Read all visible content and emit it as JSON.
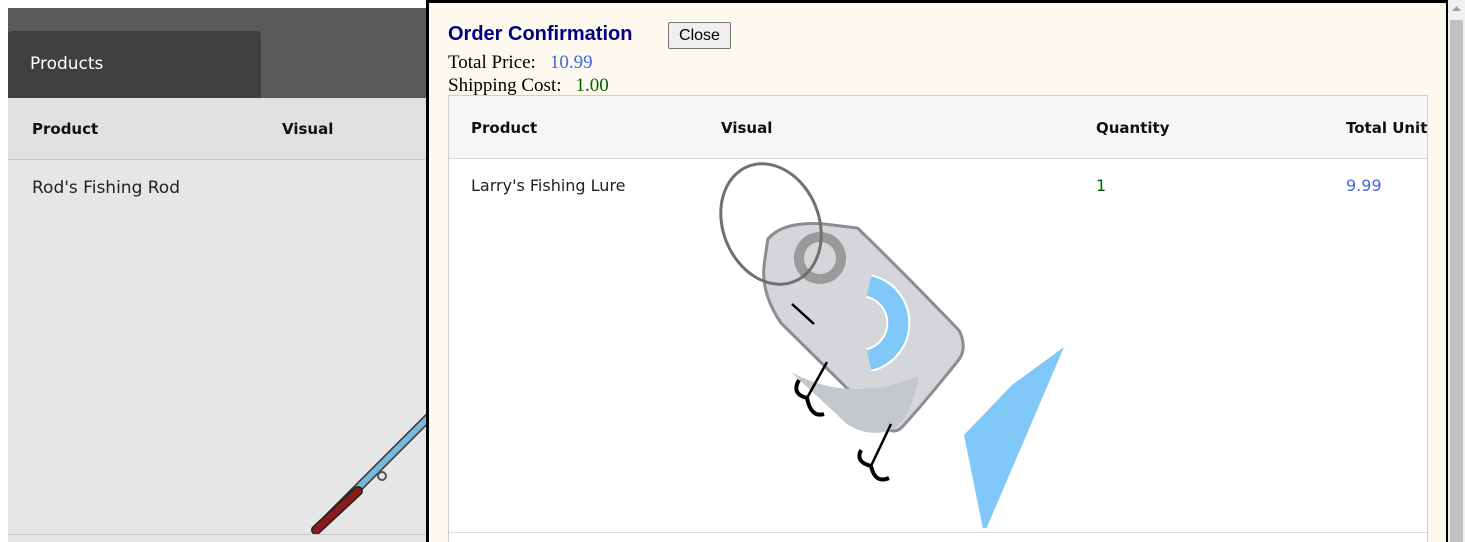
{
  "background_app": {
    "tab_label": "Products",
    "table_headers": [
      "Product",
      "Visual"
    ],
    "rows": [
      {
        "product": "Rod's Fishing Rod",
        "visual_icon": "fishing-rod-image"
      }
    ]
  },
  "dialog": {
    "title": "Order Confirmation",
    "close_label": "Close",
    "total_price_label": "Total Price:",
    "total_price_value": "10.99",
    "shipping_label": "Shipping Cost:",
    "shipping_value": "1.00",
    "table": {
      "headers": [
        "Product",
        "Visual",
        "Quantity",
        "Total Unit"
      ],
      "rows": [
        {
          "product": "Larry's Fishing Lure",
          "visual_icon": "fishing-lure-image",
          "quantity": "1",
          "total_unit": "9.99"
        }
      ]
    }
  },
  "colors": {
    "title": "#000080",
    "price": "#4169e1",
    "shipping": "#006400",
    "quantity": "#006400",
    "total_unit": "#4169e1",
    "dialog_bg": "#fdf9ee",
    "bg_header": "#5a5a5a",
    "tab": "#3f3f3f"
  }
}
